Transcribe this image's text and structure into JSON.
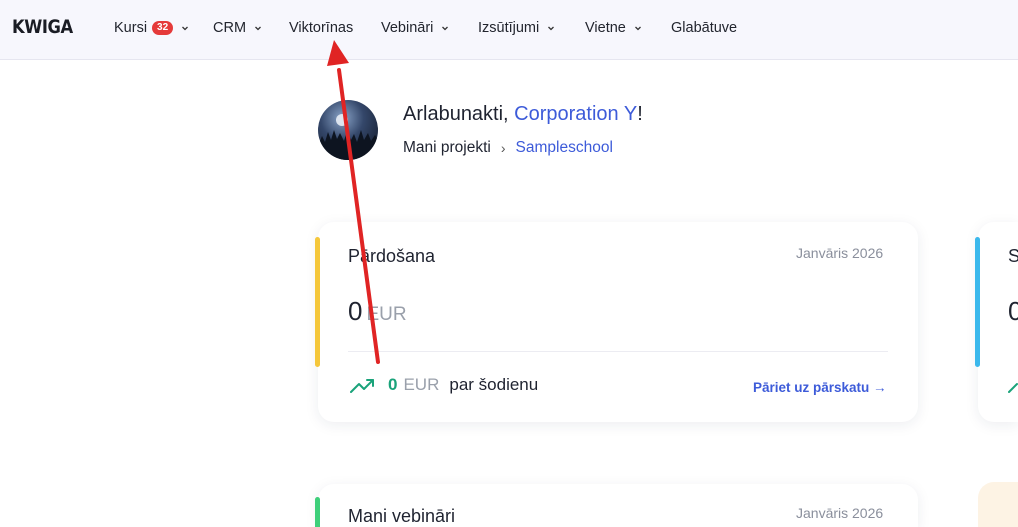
{
  "header": {
    "logo": "KWIGA",
    "nav": [
      {
        "label": "Kursi",
        "badge": "32",
        "dropdown": true
      },
      {
        "label": "CRM",
        "dropdown": true
      },
      {
        "label": "Viktorīnas",
        "dropdown": false
      },
      {
        "label": "Vebināri",
        "dropdown": true
      },
      {
        "label": "Izsūtījumi",
        "dropdown": true
      },
      {
        "label": "Vietne",
        "dropdown": true
      },
      {
        "label": "Glabātuve",
        "dropdown": false
      }
    ]
  },
  "greeting": {
    "prefix": "Arlabunakti, ",
    "company": "Corporation Y",
    "suffix": "!"
  },
  "breadcrumb": {
    "root": "Mani projekti",
    "current": "Sampleschool"
  },
  "sales_card": {
    "title": "Pārdošana",
    "period": "Janvāris 2026",
    "total_value": "0",
    "currency": "EUR",
    "today_value": "0",
    "today_label": "par šodienu",
    "report_link": "Pāriet uz pārskatu →",
    "accent_color": "#f5c73b"
  },
  "second_card": {
    "title_partial": "S",
    "value_partial": "0",
    "accent_color": "#3bb8ec"
  },
  "webinars_card": {
    "title": "Mani vebināri",
    "period": "Janvāris 2026",
    "accent_color": "#3ecf7a"
  },
  "colors": {
    "link": "#3d5bd9",
    "positive": "#1aa37a",
    "annotation_arrow": "#e02424"
  }
}
